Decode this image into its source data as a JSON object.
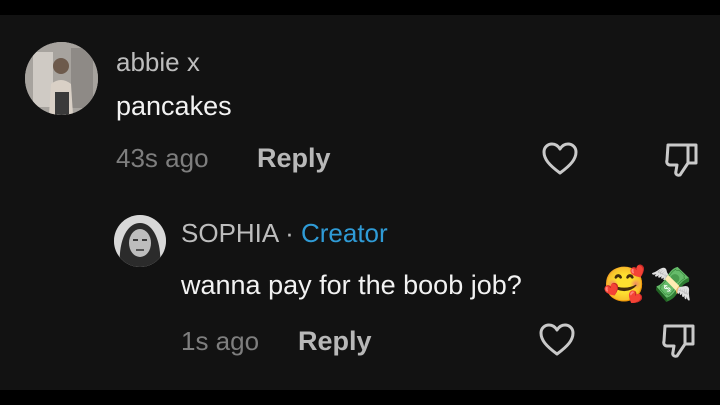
{
  "comments": [
    {
      "author": "abbie x",
      "text": "pancakes",
      "time": "43s ago",
      "reply_label": "Reply",
      "like_icon": "heart-icon",
      "dislike_icon": "thumbs-down-icon"
    },
    {
      "author": "SOPHIA",
      "separator": "·",
      "badge": "Creator",
      "text": "wanna pay for the boob job?",
      "emoji_1": "🥰",
      "emoji_2": "💸",
      "time": "1s ago",
      "reply_label": "Reply",
      "like_icon": "heart-icon",
      "dislike_icon": "thumbs-down-icon"
    }
  ],
  "colors": {
    "background": "#121212",
    "creator_badge": "#2f9bd6",
    "text": "#f2f2f2",
    "muted": "#7e7e7e"
  }
}
